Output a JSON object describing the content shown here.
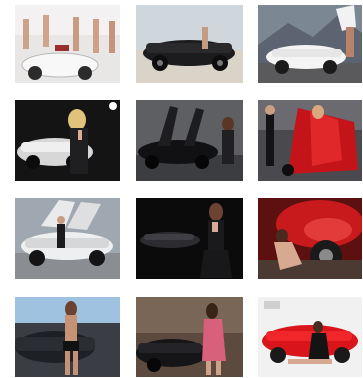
{
  "gallery": {
    "thumbnails": [
      {
        "subject": "group-with-white-car"
      },
      {
        "subject": "black-roadster-desert"
      },
      {
        "subject": "white-sports-car-mountains"
      },
      {
        "subject": "white-car-dark-studio"
      },
      {
        "subject": "black-car-gullwing-doors"
      },
      {
        "subject": "red-dress-black-car"
      },
      {
        "subject": "silver-gullwing-car"
      },
      {
        "subject": "black-car-night"
      },
      {
        "subject": "red-car-interior"
      },
      {
        "subject": "black-car-rear-view"
      },
      {
        "subject": "dark-car-street"
      },
      {
        "subject": "red-convertible"
      }
    ]
  }
}
